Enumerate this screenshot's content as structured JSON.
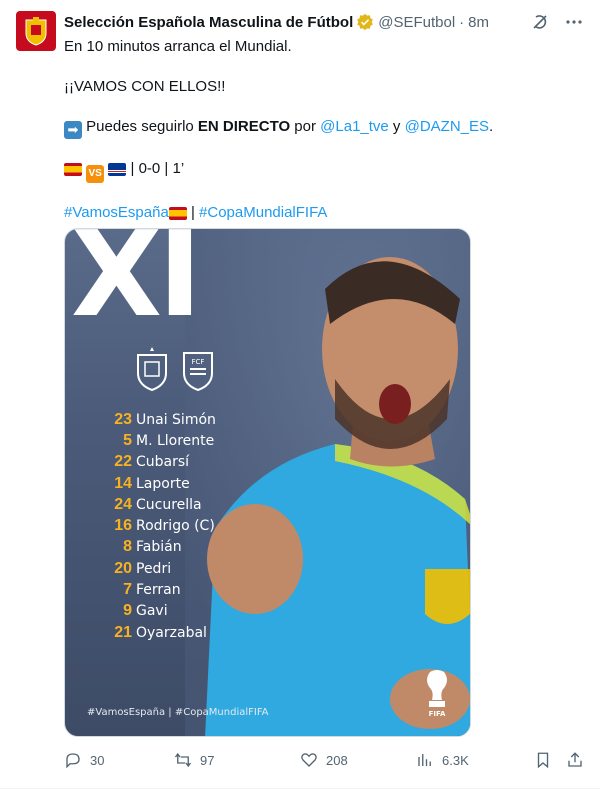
{
  "author": {
    "name": "Selección Española Masculina de Fútbol",
    "handle": "@SEFutbol",
    "separator": "·",
    "time": "8m"
  },
  "tweet": {
    "line1": "En 10 minutos arranca el Mundial.",
    "line2": "¡¡VAMOS CON ELLOS!!",
    "line3_pre": " Puedes seguirlo ",
    "line3_bold": "EN DIRECTO",
    "line3_mid": " por ",
    "mention1": "@La1_tve",
    "line3_and": " y ",
    "mention2": "@DAZN_ES",
    "line3_end": ".",
    "vs_label": "VS",
    "score": " | 0-0 | 1’",
    "hashtag1": "#VamosEspaña",
    "hashtag_sep": " | ",
    "hashtag2": "#CopaMundialFIFA"
  },
  "media": {
    "title": "XI",
    "lineup": [
      {
        "number": "23",
        "name": "Unai Simón"
      },
      {
        "number": "5",
        "name": "M. Llorente"
      },
      {
        "number": "22",
        "name": "Cubarsí"
      },
      {
        "number": "14",
        "name": "Laporte"
      },
      {
        "number": "24",
        "name": "Cucurella"
      },
      {
        "number": "16",
        "name": "Rodrigo (C)"
      },
      {
        "number": "8",
        "name": "Fabián"
      },
      {
        "number": "20",
        "name": "Pedri"
      },
      {
        "number": "7",
        "name": "Ferran"
      },
      {
        "number": "9",
        "name": "Gavi"
      },
      {
        "number": "21",
        "name": "Oyarzabal"
      }
    ],
    "caption": "#VamosEspaña  |  #CopaMundialFIFA",
    "fifa_label": "FIFA",
    "crest_label": "FCF"
  },
  "actions": {
    "replies": "30",
    "reposts": "97",
    "likes": "208",
    "views": "6.3K"
  },
  "icons": {
    "verified": "verified-badge-icon",
    "grok": "grok-icon",
    "more": "more-icon",
    "reply": "reply-icon",
    "repost": "repost-icon",
    "like": "like-icon",
    "views": "views-icon",
    "bookmark": "bookmark-icon",
    "share": "share-icon"
  },
  "colors": {
    "link": "#1d9bf0",
    "gold": "#f6b221",
    "muted": "#536471",
    "badge": "#e2b719"
  }
}
